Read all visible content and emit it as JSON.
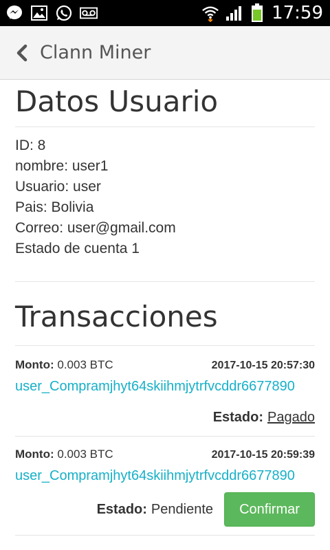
{
  "status_bar": {
    "time": "17:59",
    "left_icons": [
      "messenger-icon",
      "image-icon",
      "whatsapp-icon",
      "voicemail-icon"
    ],
    "right_icons": [
      "wifi-icon",
      "signal-icon",
      "battery-icon"
    ]
  },
  "app_bar": {
    "title": "Clann Miner"
  },
  "user_section": {
    "title": "Datos Usuario",
    "lines": [
      "ID: 8",
      "nombre: user1",
      "Usuario: user",
      "Pais: Bolivia",
      "Correo: user@gmail.com",
      "Estado de cuenta 1"
    ]
  },
  "transactions_section": {
    "title": "Transacciones",
    "amount_label": "Monto:",
    "status_label": "Estado:",
    "items": [
      {
        "amount": "0.003 BTC",
        "date": "2017-10-15 20:57:30",
        "reference": "user_Compramjhyt64skiihmjytrfvcddr6677890",
        "status": "Pagado"
      },
      {
        "amount": "0.003 BTC",
        "date": "2017-10-15 20:59:39",
        "reference": "user_Compramjhyt64skiihmjytrfvcddr6677890",
        "status": "Pendiente",
        "action_label": "Confirmar"
      }
    ]
  },
  "colors": {
    "accent_link": "#17b0c8",
    "confirm_button": "#5cb85c",
    "status_bar": "#000000",
    "app_bar": "#f4f4f4"
  }
}
